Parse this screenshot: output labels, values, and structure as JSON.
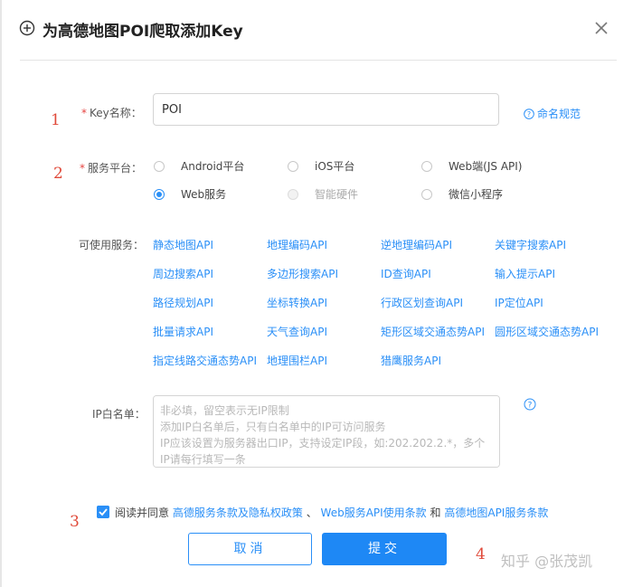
{
  "dialog": {
    "title": "为高德地图POI爬取添加Key",
    "close_icon": "close-icon",
    "header_icon": "plus-circle-icon"
  },
  "markers": [
    "1",
    "2",
    "3",
    "4"
  ],
  "form": {
    "key_name": {
      "required": "*",
      "label": "Key名称：",
      "value": "POI",
      "help_text": "命名规范"
    },
    "platform": {
      "required": "*",
      "label": "服务平台：",
      "options": [
        {
          "label": "Android平台",
          "selected": false,
          "disabled": false
        },
        {
          "label": "iOS平台",
          "selected": false,
          "disabled": false
        },
        {
          "label": "Web端(JS API)",
          "selected": false,
          "disabled": false
        },
        {
          "label": "Web服务",
          "selected": true,
          "disabled": false
        },
        {
          "label": "智能硬件",
          "selected": false,
          "disabled": true
        },
        {
          "label": "微信小程序",
          "selected": false,
          "disabled": false
        }
      ]
    },
    "services": {
      "label": "可使用服务：",
      "items": [
        "静态地图API",
        "地理编码API",
        "逆地理编码API",
        "关键字搜索API",
        "周边搜索API",
        "多边形搜索API",
        "ID查询API",
        "输入提示API",
        "路径规划API",
        "坐标转换API",
        "行政区划查询API",
        "IP定位API",
        "批量请求API",
        "天气查询API",
        "矩形区域交通态势API",
        "圆形区域交通态势API",
        "指定线路交通态势API",
        "地理围栏API",
        "猎鹰服务API"
      ]
    },
    "ip_whitelist": {
      "label": "IP白名单：",
      "placeholder": "非必填，留空表示无IP限制\n添加IP白名单后，只有白名单中的IP可访问服务\nIP应该设置为服务器出口IP，支持设定IP段，如:202.202.2.*，多个IP请每行填写一条",
      "value": ""
    },
    "agreement": {
      "checked": true,
      "prefix": "阅读并同意",
      "link1": "高德服务条款及隐私权政策",
      "sep": "、",
      "link2": "Web服务API使用条款",
      "and": "和",
      "link3": "高德地图API服务条款"
    }
  },
  "buttons": {
    "cancel": "取消",
    "submit": "提交"
  },
  "watermark": "知乎 @张茂凯",
  "colors": {
    "accent": "#2a8ff7",
    "required": "#e64340",
    "marker": "#e04a3a"
  }
}
